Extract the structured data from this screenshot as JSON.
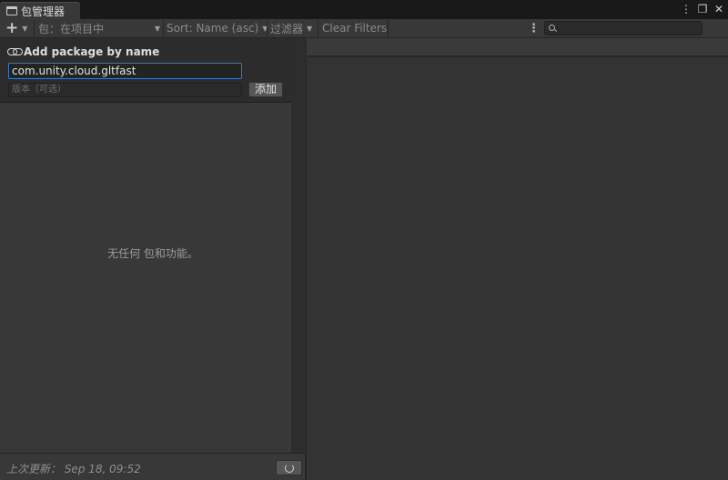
{
  "window": {
    "tab_title": "包管理器",
    "more_icon": "⋮",
    "maximize_icon": "❐",
    "close_icon": "✕"
  },
  "toolbar": {
    "add_icon": "+",
    "scope_label": "包：在项目中",
    "sort_label": "Sort: Name (asc)",
    "filters_label": "过滤器",
    "clear_filters_label": "Clear Filters",
    "more_icon": "⋮",
    "search_placeholder": ""
  },
  "add_by_name": {
    "title": "Add package by name",
    "name_value": "com.unity.cloud.gltfast",
    "version_placeholder": "版本（可选）",
    "add_label": "添加"
  },
  "package_list": {
    "empty_message": "无任何 包和功能。"
  },
  "footer": {
    "last_update": "上次更新：  Sep 18, 09:52"
  },
  "colors": {
    "focus_border": "#3a79bb",
    "toolbar_bg": "#383838",
    "panel_bg": "#333333"
  }
}
